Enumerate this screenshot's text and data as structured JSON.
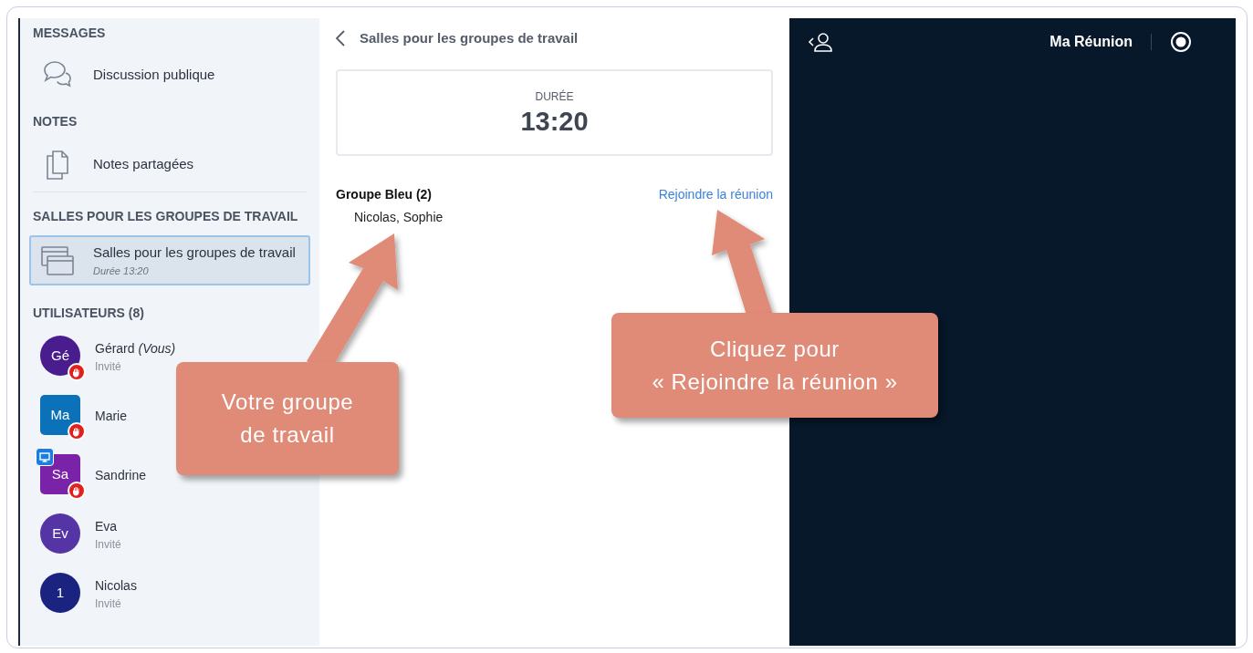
{
  "sidebar": {
    "sections": [
      {
        "heading": "MESSAGES",
        "items": [
          {
            "kind": "chat",
            "label": "Discussion publique",
            "selected": false
          }
        ]
      },
      {
        "heading": "NOTES",
        "items": [
          {
            "kind": "notes",
            "label": "Notes partagées",
            "selected": false
          }
        ]
      },
      {
        "heading": "SALLES POUR LES GROUPES DE TRAVAIL",
        "items": [
          {
            "kind": "rooms",
            "label": "Salles pour les groupes de travail",
            "subtitle": "Durée 13:20",
            "selected": true
          }
        ]
      }
    ],
    "users_heading": "UTILISATEURS (8)",
    "users": [
      {
        "initials": "Gé",
        "name": "Gérard *(Vous)*",
        "role": "Invité",
        "kind": "round",
        "color": "#4a1d8f",
        "hand_raised": true,
        "presenter": false
      },
      {
        "initials": "Ma",
        "name": "Marie",
        "kind": "square",
        "color": "#0b72b9",
        "hand_raised": true,
        "presenter": false
      },
      {
        "initials": "Sa",
        "name": "Sandrine",
        "kind": "square",
        "color": "#7a22a8",
        "hand_raised": true,
        "presenter": true
      },
      {
        "initials": "Ev",
        "name": "Eva",
        "role": "Invité",
        "kind": "round",
        "color": "#5534a6",
        "hand_raised": false,
        "presenter": false
      },
      {
        "initials": "1",
        "name": "Nicolas",
        "role": "Invité",
        "kind": "round",
        "color": "#1b2380",
        "hand_raised": false,
        "presenter": false
      }
    ]
  },
  "panel": {
    "title": "Salles pour les groupes de travail",
    "duration_label": "DURÉE",
    "duration": "13:20",
    "groups": [
      {
        "name": "Groupe Bleu (2)",
        "members": "Nicolas, Sophie",
        "join": "Rejoindre la réunion"
      }
    ]
  },
  "meeting": {
    "title": "Ma Réunion"
  },
  "callouts": [
    {
      "lines": [
        "Votre groupe",
        "de travail"
      ]
    },
    {
      "lines": [
        "Cliquez pour",
        "« Rejoindre la réunion »"
      ]
    }
  ]
}
